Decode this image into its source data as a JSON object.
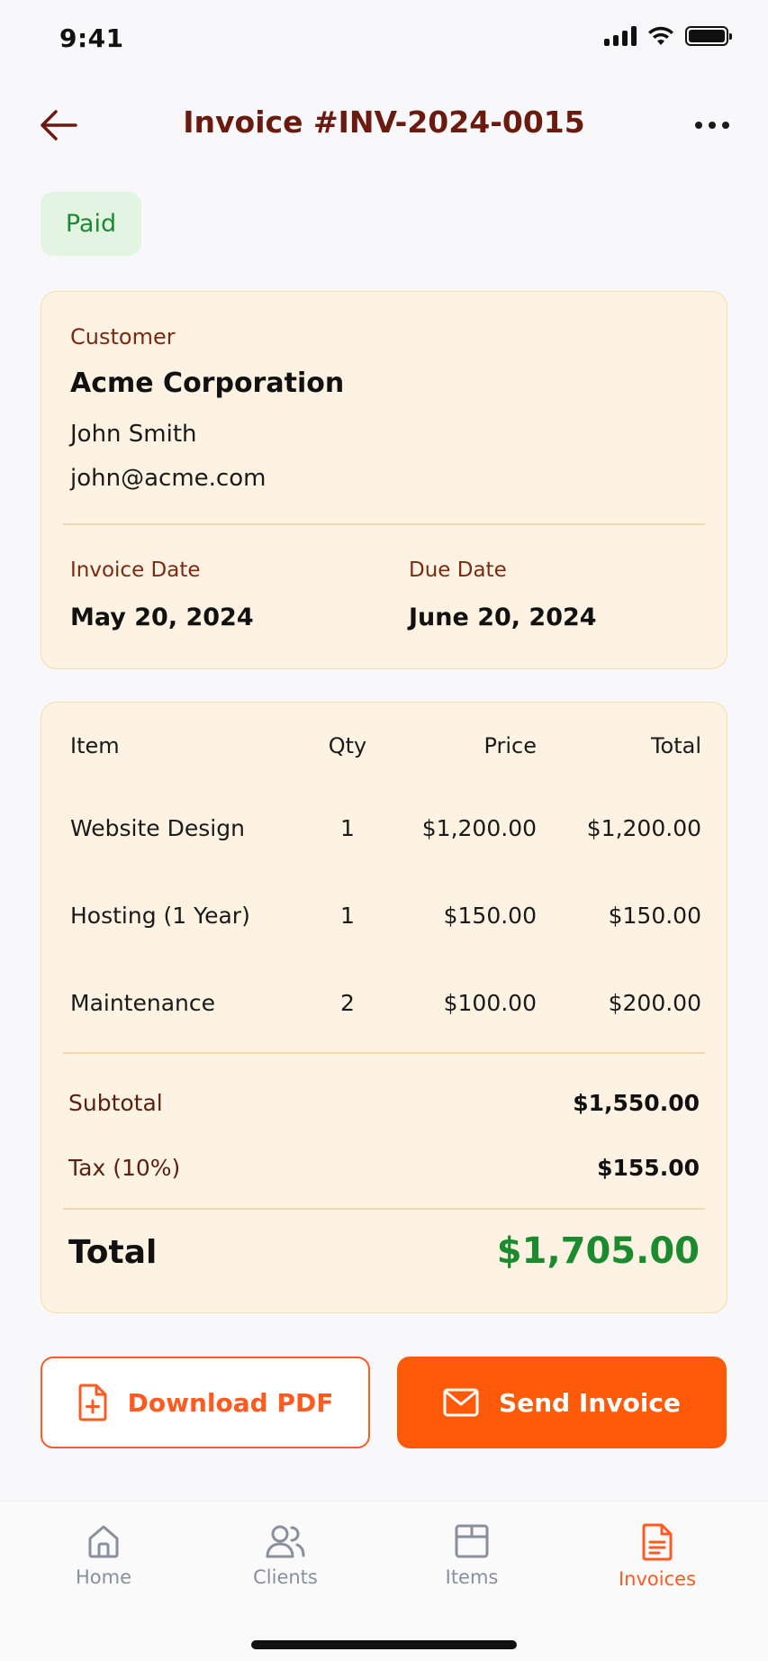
{
  "status_bar": {
    "time": "9:41"
  },
  "header": {
    "title": "Invoice #INV-2024-0015"
  },
  "status_badge": {
    "label": "Paid",
    "color": "#1c8a2e"
  },
  "customer": {
    "label": "Customer",
    "company": "Acme Corporation",
    "contact_name": "John Smith",
    "email": "john@acme.com",
    "invoice_date_label": "Invoice Date",
    "invoice_date": "May 20, 2024",
    "due_date_label": "Due Date",
    "due_date": "June 20, 2024"
  },
  "items_table": {
    "columns": {
      "item": "Item",
      "qty": "Qty",
      "price": "Price",
      "total": "Total"
    },
    "rows": [
      {
        "item": "Website Design",
        "qty": "1",
        "price": "$1,200.00",
        "total": "$1,200.00"
      },
      {
        "item": "Hosting (1 Year)",
        "qty": "1",
        "price": "$150.00",
        "total": "$150.00"
      },
      {
        "item": "Maintenance",
        "qty": "2",
        "price": "$100.00",
        "total": "$200.00"
      }
    ],
    "subtotal_label": "Subtotal",
    "subtotal": "$1,550.00",
    "tax_label": "Tax (10%)",
    "tax": "$155.00",
    "total_label": "Total",
    "total": "$1,705.00"
  },
  "actions": {
    "download_label": "Download PDF",
    "send_label": "Send Invoice"
  },
  "tabbar": {
    "items": [
      {
        "label": "Home",
        "icon": "home-icon"
      },
      {
        "label": "Clients",
        "icon": "users-icon"
      },
      {
        "label": "Items",
        "icon": "box-icon"
      },
      {
        "label": "Invoices",
        "icon": "document-icon",
        "active": true
      }
    ]
  },
  "colors": {
    "accent": "#ff5a1f",
    "title": "#6b1a0f",
    "card_bg": "#fef3e2",
    "success": "#1c8a2e"
  }
}
